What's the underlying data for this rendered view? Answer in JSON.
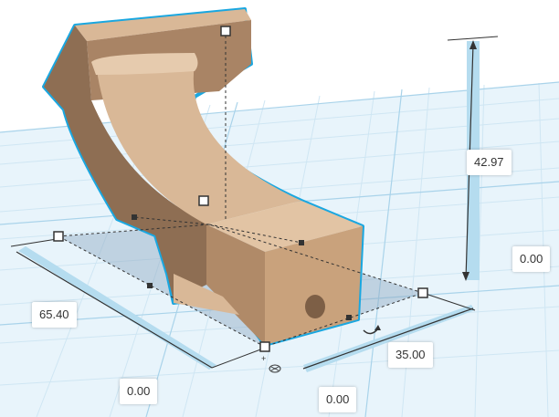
{
  "dimensions": {
    "length": "65.40",
    "width": "35.00",
    "height": "42.97",
    "origin_x": "0.00",
    "origin_y": "0.00",
    "elevation": "0.00"
  },
  "colors": {
    "grid_background": "#e8f4fb",
    "grid_minor": "#cfe6f3",
    "grid_major": "#a9d3ea",
    "shape_face_light": "#d9b897",
    "shape_face_mid": "#c9a27c",
    "shape_face_dark": "#8e6e53",
    "selection_outline": "#1aa7e0",
    "shadow": "#8fa8c0",
    "handle_fill": "#ffffff",
    "handle_stroke": "#333333",
    "dimension_line": "#333333",
    "dimension_bar": "#b5dcef"
  },
  "icons": {
    "rotate": "rotate-arrow-icon",
    "snap": "snap-grid-icon"
  }
}
